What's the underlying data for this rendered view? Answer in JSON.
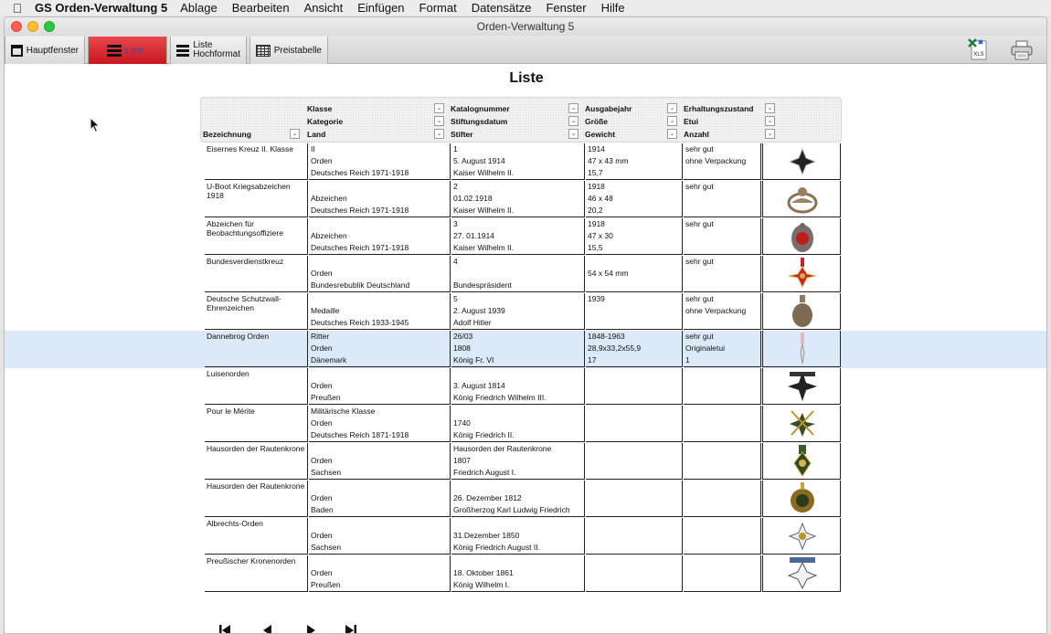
{
  "menubar": {
    "app_name": "GS Orden-Verwaltung 5",
    "items": [
      "Ablage",
      "Bearbeiten",
      "Ansicht",
      "Einfügen",
      "Format",
      "Datensätze",
      "Fenster",
      "Hilfe"
    ]
  },
  "window": {
    "title": "Orden-Verwaltung 5"
  },
  "toolbar": {
    "hauptfenster": "Hauptfenster",
    "liste": "Liste",
    "liste_hoch_1": "Liste",
    "liste_hoch_2": "Hochformat",
    "preistabelle": "Preistabelle",
    "xls_label": "XLS"
  },
  "page": {
    "title": "Liste"
  },
  "headers": {
    "bezeichnung": "Bezeichnung",
    "klasse": "Klasse",
    "kategorie": "Kategorie",
    "land": "Land",
    "katalognummer": "Katalognummer",
    "stiftungsdatum": "Stiftungsdatum",
    "stifter": "Stifter",
    "ausgabejahr": "Ausgabejahr",
    "groesse": "Größe",
    "gewicht": "Gewicht",
    "erhaltungszustand": "Erhaltungszustand",
    "etui": "Etui",
    "anzahl": "Anzahl"
  },
  "rows": [
    {
      "name": "Eisernes Kreuz II. Klasse",
      "c1": [
        "II",
        "Orden",
        "Deutsches Reich 1971-1918"
      ],
      "c2": [
        "1",
        "5. August 1914",
        "Kaiser Wilhelm II."
      ],
      "c3": [
        "1914",
        "47 x 43 mm",
        "15,7"
      ],
      "c4": [
        "sehr gut",
        "ohne Verpackung",
        ""
      ]
    },
    {
      "name": "U-Boot Kriegsabzeichen 1918",
      "c1": [
        "",
        "Abzeichen",
        "Deutsches Reich 1971-1918"
      ],
      "c2": [
        "2",
        "01.02.1918",
        "Kaiser Wilhelm II."
      ],
      "c3": [
        "1918",
        "46 x 48",
        "20,2"
      ],
      "c4": [
        "sehr gut",
        "",
        ""
      ]
    },
    {
      "name": "Abzeichen für Beobachtungsoffiziere",
      "c1": [
        "",
        "Abzeichen",
        "Deutsches Reich 1971-1918"
      ],
      "c2": [
        "3",
        "27. 01.1914",
        "Kaiser Wilhelm II."
      ],
      "c3": [
        "1918",
        "47 x 30",
        "15,5"
      ],
      "c4": [
        "sehr gut",
        "",
        ""
      ]
    },
    {
      "name": "Bundesverdienstkreuz",
      "c1": [
        "",
        "Orden",
        "Bundesrebublik Deutschland"
      ],
      "c2": [
        "4",
        "",
        "Bundespräsident"
      ],
      "c3": [
        "",
        "54 x 54 mm",
        ""
      ],
      "c4": [
        "sehr gut",
        "",
        ""
      ]
    },
    {
      "name": "Deutsche Schutzwall-Ehrenzeichen",
      "c1": [
        "",
        "Medaille",
        "Deutsches Reich 1933-1945"
      ],
      "c2": [
        "5",
        "2. August 1939",
        "Adolf Hitler"
      ],
      "c3": [
        "1939",
        "",
        ""
      ],
      "c4": [
        "sehr gut",
        "ohne Verpackung",
        ""
      ]
    },
    {
      "name": "Dannebrog Orden",
      "c1": [
        "Ritter",
        "Orden",
        "Dänemark"
      ],
      "c2": [
        "26/03",
        "1808",
        "König Fr. VI"
      ],
      "c3": [
        "1848-1963",
        "28,9x33,2x55,9",
        "17"
      ],
      "c4": [
        "sehr gut",
        "Originaletui",
        "1"
      ]
    },
    {
      "name": "Luisenorden",
      "c1": [
        "",
        "Orden",
        "Preußen"
      ],
      "c2": [
        "",
        "3. August 1814",
        "König Friedrich Wilhelm III."
      ],
      "c3": [
        "",
        "",
        ""
      ],
      "c4": [
        "",
        "",
        ""
      ]
    },
    {
      "name": "Pour le Mérite",
      "c1": [
        "Militärische Klasse",
        "Orden",
        "Deutsches Reich 1871-1918"
      ],
      "c2": [
        "",
        "1740",
        "König Friedrich II."
      ],
      "c3": [
        "",
        "",
        ""
      ],
      "c4": [
        "",
        "",
        ""
      ]
    },
    {
      "name": "Hausorden der Rautenkrone",
      "c1": [
        "",
        "Orden",
        "Sachsen"
      ],
      "c2": [
        "Hausorden der Rautenkrone",
        "1807",
        "Friedrich August I."
      ],
      "c3": [
        "",
        "",
        ""
      ],
      "c4": [
        "",
        "",
        ""
      ]
    },
    {
      "name": "Hausorden der Rautenkrone",
      "c1": [
        "",
        "Orden",
        "Baden"
      ],
      "c2": [
        "",
        "26. Dezember 1812",
        "Großherzog Karl Ludwig Friedrich"
      ],
      "c3": [
        "",
        "",
        ""
      ],
      "c4": [
        "",
        "",
        ""
      ]
    },
    {
      "name": "Albrechts-Orden",
      "c1": [
        "",
        "Orden",
        "Sachsen"
      ],
      "c2": [
        "",
        "31.Dezember 1850",
        "König Friedrich August II."
      ],
      "c3": [
        "",
        "",
        ""
      ],
      "c4": [
        "",
        "",
        ""
      ]
    },
    {
      "name": "Preußischer Kronenorden",
      "c1": [
        "",
        "Orden",
        "Preußen"
      ],
      "c2": [
        "",
        "18. Oktober 1861",
        "König Wilhelm I."
      ],
      "c3": [
        "",
        "",
        ""
      ],
      "c4": [
        "",
        "",
        ""
      ]
    }
  ],
  "icons": {
    "nav": [
      "first-record-icon",
      "previous-record-icon",
      "next-record-icon",
      "last-record-icon"
    ],
    "medals": [
      "iron-cross-icon",
      "u-boat-badge-icon",
      "observer-badge-icon",
      "merit-cross-icon",
      "westwall-medal-icon",
      "dannebrog-order-icon",
      "luisenorden-icon",
      "pour-le-merite-icon",
      "rautenkrone-order-icon",
      "rautenkrone-baden-icon",
      "albrechts-order-icon",
      "kronenorden-icon"
    ]
  },
  "colors": {
    "selected_row": "#dbe9f8",
    "active_tab": "#c8161e",
    "active_tab_text": "#3a4ac0"
  }
}
